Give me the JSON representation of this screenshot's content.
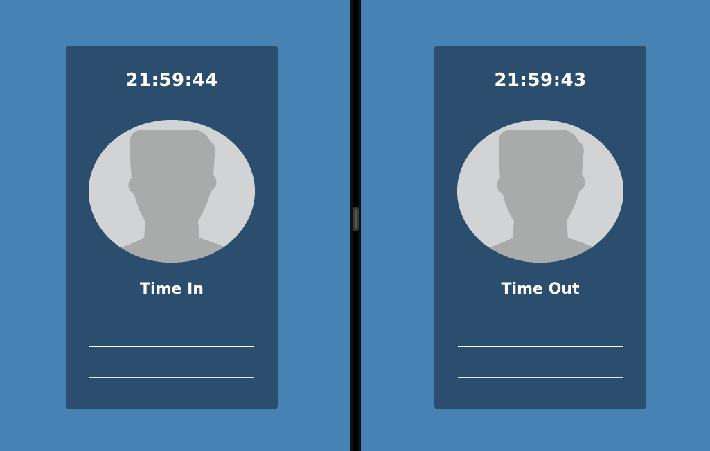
{
  "panels": [
    {
      "clock": "21:59:44",
      "label": "Time In",
      "avatar_icon": "person-silhouette-icon"
    },
    {
      "clock": "21:59:43",
      "label": "Time Out",
      "avatar_icon": "person-silhouette-icon"
    }
  ],
  "colors": {
    "background": "#4682b4",
    "card": "#2b4e6e",
    "avatar_bg": "#d1d3d4",
    "avatar_silhouette": "#a9abab",
    "divider": "#111111"
  }
}
